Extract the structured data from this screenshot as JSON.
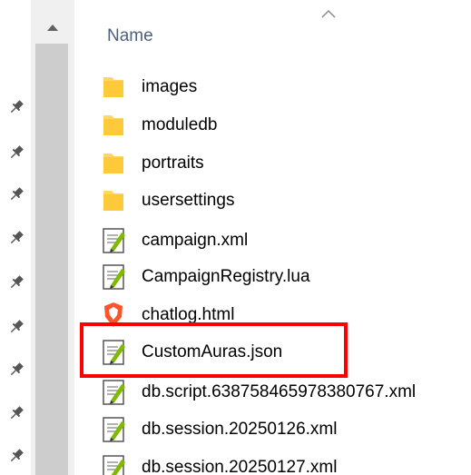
{
  "column_header": {
    "name_label": "Name"
  },
  "files": [
    {
      "name": "images",
      "type": "folder"
    },
    {
      "name": "moduledb",
      "type": "folder"
    },
    {
      "name": "portraits",
      "type": "folder"
    },
    {
      "name": "usersettings",
      "type": "folder"
    },
    {
      "name": "campaign.xml",
      "type": "text"
    },
    {
      "name": "CampaignRegistry.lua",
      "type": "text"
    },
    {
      "name": "chatlog.html",
      "type": "brave-html"
    },
    {
      "name": "CustomAuras.json",
      "type": "text",
      "highlighted": true
    },
    {
      "name": "db.script.638758465978380767.xml",
      "type": "text"
    },
    {
      "name": "db.session.20250126.xml",
      "type": "text"
    },
    {
      "name": "db.session.20250127.xml",
      "type": "text"
    }
  ],
  "colors": {
    "folder": "#ffd767",
    "highlight": "#ff0000",
    "scroll_track": "#f0f0f0",
    "scroll_thumb": "#cdcdcd",
    "header_text": "#4c607a"
  }
}
